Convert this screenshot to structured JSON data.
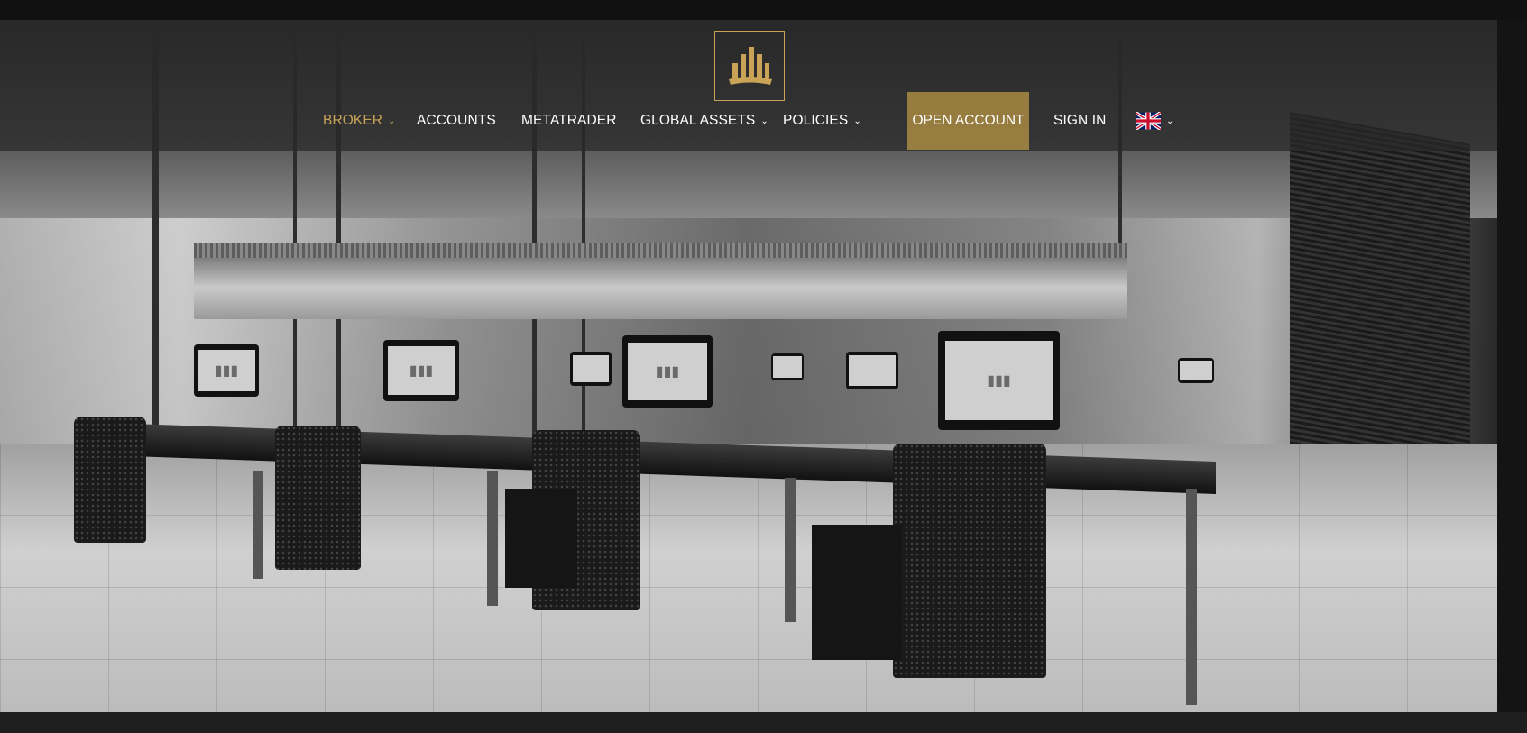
{
  "nav": {
    "items": [
      {
        "label": "BROKER",
        "has_dropdown": true,
        "active": true
      },
      {
        "label": "ACCOUNTS",
        "has_dropdown": false
      },
      {
        "label": "METATRADER",
        "has_dropdown": false
      },
      {
        "label": "GLOBAL ASSETS",
        "has_dropdown": true
      },
      {
        "label": "POLICIES",
        "has_dropdown": true
      }
    ],
    "open_account_label": "OPEN ACCOUNT",
    "sign_in_label": "SIGN IN",
    "language": {
      "icon": "uk-flag-icon",
      "has_dropdown": true
    }
  },
  "logo": {
    "icon": "bar-crown-logo-icon"
  },
  "hero": {
    "description_icon": "office-photo"
  },
  "colors": {
    "accent": "#c9a457",
    "header_bg": "#282828",
    "open_account_bg": "#b99646",
    "page_bg": "#111111"
  }
}
